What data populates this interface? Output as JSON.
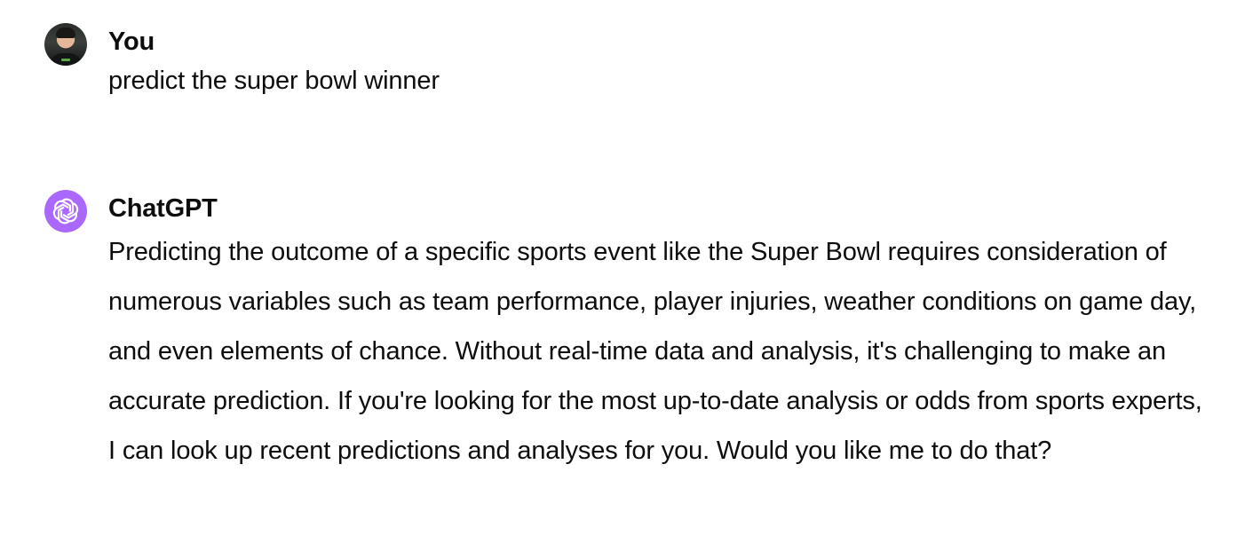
{
  "conversation": {
    "user": {
      "author": "You",
      "text": "predict the super bowl winner"
    },
    "assistant": {
      "author": "ChatGPT",
      "text": "Predicting the outcome of a specific sports event like the Super Bowl requires consideration of numerous variables such as team performance, player injuries, weather conditions on game day, and even elements of chance. Without real-time data and analysis, it's challenging to make an accurate prediction. If you're looking for the most up-to-date analysis or odds from sports experts, I can look up recent predictions and analyses for you. Would you like me to do that?"
    }
  },
  "icons": {
    "user_avatar": "user-avatar-photo",
    "assistant_avatar": "openai-logo-icon"
  },
  "colors": {
    "assistant_avatar_bg": "#ab68ff",
    "text": "#0d0d0d",
    "background": "#ffffff"
  }
}
